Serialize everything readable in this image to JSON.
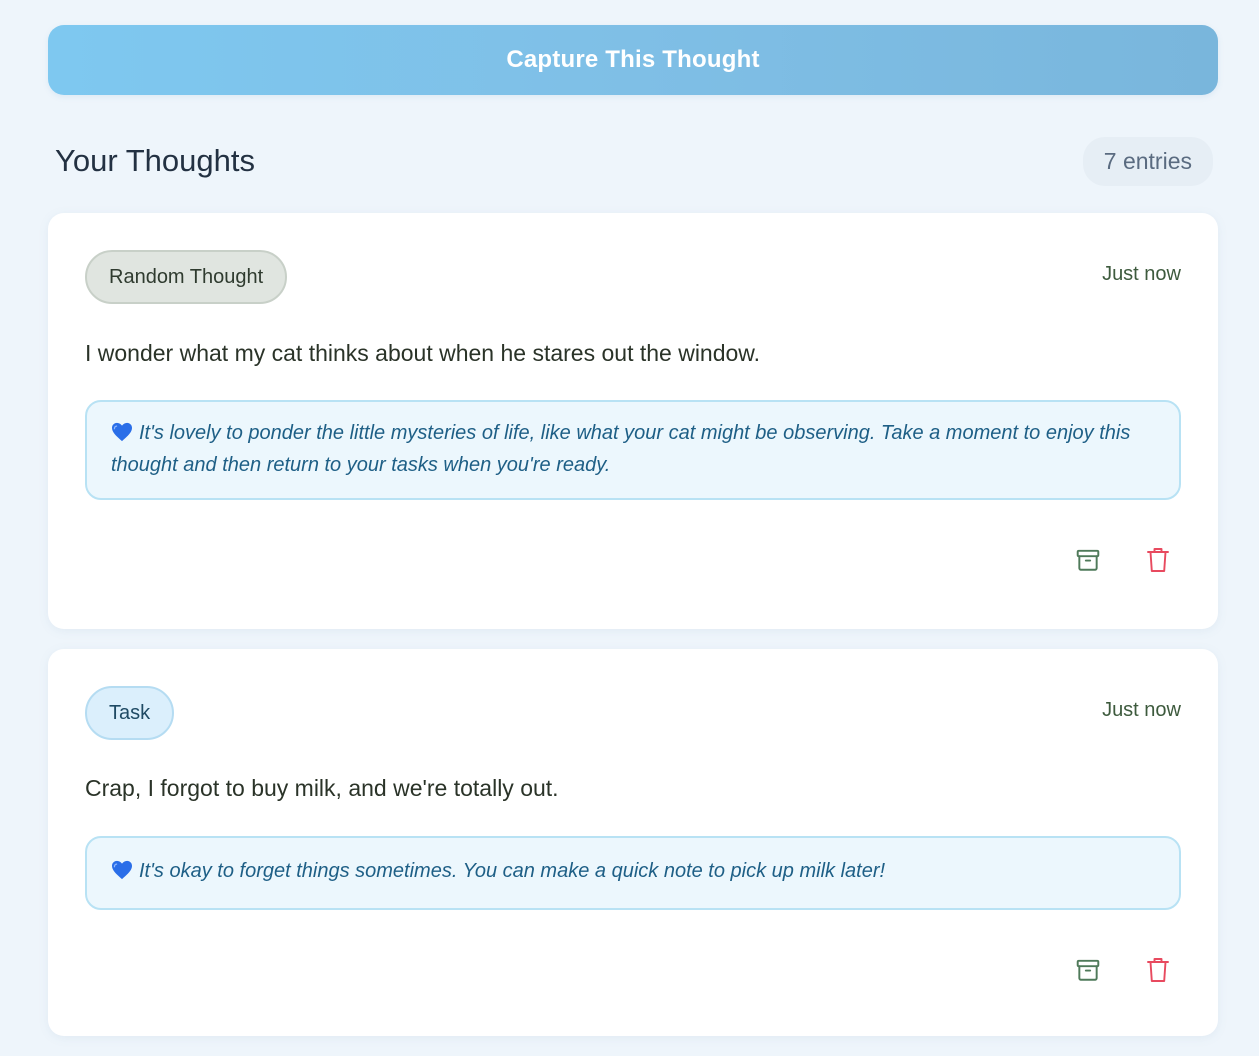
{
  "capture_button": {
    "label": "Capture This Thought"
  },
  "list_header": {
    "title": "Your Thoughts",
    "count_label": "7 entries"
  },
  "entries": [
    {
      "tag": "Random Thought",
      "timestamp": "Just now",
      "text": "I wonder what my cat thinks about when he stares out the window.",
      "note": "It's lovely to ponder the little mysteries of life, like what your cat might be observing. Take a moment to enjoy this thought and then return to your tasks when you're ready."
    },
    {
      "tag": "Task",
      "timestamp": "Just now",
      "text": "Crap, I forgot to buy milk, and we're totally out.",
      "note": "It's okay to forget things sometimes. You can make a quick note to pick up milk later!"
    }
  ],
  "icons": {
    "note": "blue-heart-icon",
    "archive": "archive-icon",
    "delete": "trash-icon"
  },
  "colors": {
    "accent": "#7ec8f0",
    "archive": "#4f7a5a",
    "delete": "#e84a5f",
    "note_text": "#1e5f86"
  }
}
